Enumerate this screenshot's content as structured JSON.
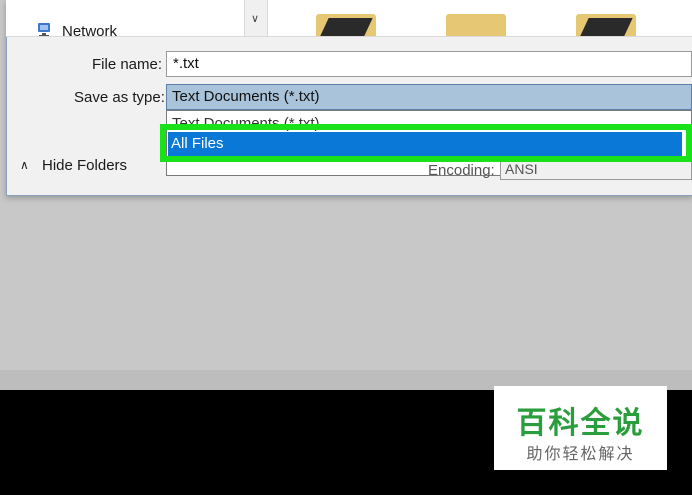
{
  "nav": {
    "network_label": "Network"
  },
  "form": {
    "file_name_label": "File name:",
    "file_name_value": "*.txt",
    "save_as_type_label": "Save as type:",
    "save_as_type_value": "Text Documents (*.txt)"
  },
  "dropdown": {
    "options": [
      "Text Documents (*.txt)",
      "All Files"
    ],
    "highlighted": "All Files"
  },
  "footer": {
    "hide_folders_label": "Hide Folders",
    "encoding_label": "Encoding:",
    "encoding_value": "ANSI"
  },
  "watermark": {
    "title": "百科全说",
    "subtitle": "助你轻松解决"
  },
  "colors": {
    "highlight_green": "#19e21a",
    "selection_blue": "#0a78d7",
    "select_bg": "#a9c3da"
  }
}
